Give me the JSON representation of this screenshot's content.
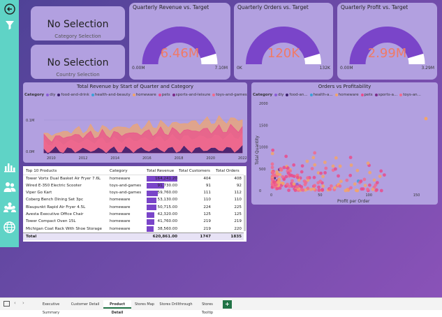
{
  "sidebar": {
    "icons": [
      "back-arrow-icon",
      "filter-icon",
      "bar-chart-icon",
      "people-icon",
      "group-icon",
      "globe-icon"
    ]
  },
  "slicers": [
    {
      "value": "No Selection",
      "label": "Category Selection"
    },
    {
      "value": "No Selection",
      "label": "Country Selection"
    }
  ],
  "gauges": [
    {
      "title": "Quarterly Revenue vs. Target",
      "value": "6.46M",
      "min": "0.00M",
      "max": "7.10M",
      "fraction": 0.91
    },
    {
      "title": "Quarterly Orders vs. Target",
      "value": "120K",
      "min": "0K",
      "max": "132K",
      "fraction": 0.91
    },
    {
      "title": "Quarterly Profit vs. Target",
      "value": "2.99M",
      "min": "0.00M",
      "max": "3.29M",
      "fraction": 0.91
    }
  ],
  "legend": {
    "label": "Category",
    "items": [
      {
        "name": "diy",
        "color": "#8a5bd6"
      },
      {
        "name": "food-and-drink",
        "color": "#3c1f6e"
      },
      {
        "name": "health-and-beauty",
        "color": "#3aa0d8"
      },
      {
        "name": "homeware",
        "color": "#f2a56a"
      },
      {
        "name": "pets",
        "color": "#e94b8c"
      },
      {
        "name": "sports-and-leisure",
        "color": "#7a2a88"
      },
      {
        "name": "toys-and-games",
        "color": "#f06a8e"
      }
    ]
  },
  "revenue_chart": {
    "title": "Total Revenue by Start of Quarter and Category",
    "y_ticks": [
      "0.1M",
      "0.0M"
    ],
    "x_ticks": [
      "2010",
      "2012",
      "2014",
      "2016",
      "2018",
      "2020",
      "2022"
    ]
  },
  "scatter_chart": {
    "title": "Orders vs Profitability",
    "legend_items": [
      "diy",
      "food-an...",
      "health-a...",
      "homeware",
      "pets",
      "sports-a...",
      "toys-an..."
    ],
    "y_label": "Total Quantity",
    "x_label": "Profit per Order",
    "y_ticks": [
      "2000",
      "1500",
      "1000",
      "500",
      "0"
    ],
    "x_ticks": [
      "0",
      "50",
      "100",
      "150"
    ]
  },
  "chart_data": [
    {
      "type": "area",
      "title": "Total Revenue by Start of Quarter and Category",
      "x": [
        "2010",
        "2012",
        "2014",
        "2016",
        "2018",
        "2020",
        "2022"
      ],
      "ylim": [
        0,
        0.13
      ],
      "series": [
        {
          "name": "homeware",
          "values": [
            0.045,
            0.06,
            0.065,
            0.072,
            0.078,
            0.085,
            0.09
          ]
        },
        {
          "name": "pets",
          "values": [
            0.035,
            0.045,
            0.048,
            0.052,
            0.057,
            0.06,
            0.065
          ]
        },
        {
          "name": "toys-and-games",
          "values": [
            0.025,
            0.03,
            0.033,
            0.036,
            0.04,
            0.042,
            0.045
          ]
        },
        {
          "name": "food-and-drink",
          "values": [
            0.005,
            0.006,
            0.006,
            0.007,
            0.007,
            0.008,
            0.008
          ]
        }
      ]
    },
    {
      "type": "scatter",
      "title": "Orders vs Profitability",
      "xlabel": "Profit per Order",
      "ylabel": "Total Quantity",
      "xlim": [
        0,
        170
      ],
      "ylim": [
        0,
        2000
      ]
    }
  ],
  "table": {
    "headers": [
      "Top 10 Products",
      "Category",
      "Total Revenue",
      "Total Customers",
      "Total Orders"
    ],
    "rows": [
      {
        "product": "Tower Vortx Dual Basket Air Fryer 7.6L",
        "category": "homeware",
        "revenue": "164,241.20",
        "customers": "404",
        "orders": "408",
        "bar": 1.0
      },
      {
        "product": "Wired E-350 Electric Scooter",
        "category": "toys-and-games",
        "revenue": "91,730.00",
        "customers": "91",
        "orders": "92",
        "bar": 0.56
      },
      {
        "product": "Viper Go Kart",
        "category": "toys-and-games",
        "revenue": "59,760.00",
        "customers": "111",
        "orders": "112",
        "bar": 0.36
      },
      {
        "product": "Coberg Bench Dining Set 3pc",
        "category": "homeware",
        "revenue": "53,130.00",
        "customers": "110",
        "orders": "110",
        "bar": 0.32
      },
      {
        "product": "Blaupunkt Rapid Air Fryer 4.5L",
        "category": "homeware",
        "revenue": "50,715.00",
        "customers": "224",
        "orders": "225",
        "bar": 0.31
      },
      {
        "product": "Avesta Executive Office Chair",
        "category": "homeware",
        "revenue": "42,320.00",
        "customers": "125",
        "orders": "125",
        "bar": 0.26
      },
      {
        "product": "Tower Compact Oven 15L",
        "category": "homeware",
        "revenue": "41,760.00",
        "customers": "219",
        "orders": "219",
        "bar": 0.25
      },
      {
        "product": "Michigan Coat Rack With Shoe Storage",
        "category": "homeware",
        "revenue": "38,560.00",
        "customers": "219",
        "orders": "220",
        "bar": 0.23
      }
    ],
    "total": {
      "label": "Total",
      "revenue": "620,861.00",
      "customers": "1747",
      "orders": "1835"
    }
  },
  "tabs": [
    "Executive Summary",
    "Customer Detail",
    "Product Detail",
    "Stores Map",
    "Stores Drillthrough",
    "Stores Tooltip"
  ],
  "active_tab": "Product Detail",
  "add_tab": "+"
}
